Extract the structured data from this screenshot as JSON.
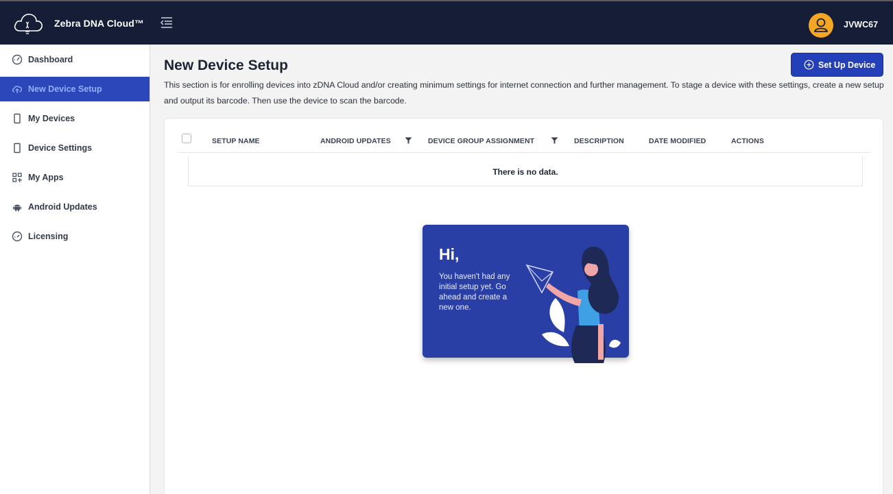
{
  "header": {
    "brand": "Zebra DNA Cloud™",
    "username": "JVWC67"
  },
  "sidebar": {
    "items": [
      {
        "label": "Dashboard",
        "icon": "dashboard-icon"
      },
      {
        "label": "New Device Setup",
        "icon": "cloud-upload-icon",
        "active": true
      },
      {
        "label": "My Devices",
        "icon": "phone-icon"
      },
      {
        "label": "Device Settings",
        "icon": "phone-icon"
      },
      {
        "label": "My Apps",
        "icon": "apps-icon"
      },
      {
        "label": "Android Updates",
        "icon": "android-icon"
      },
      {
        "label": "Licensing",
        "icon": "gauge-icon"
      }
    ]
  },
  "main": {
    "title": "New Device Setup",
    "description": "This section is for enrolling devices into zDNA Cloud and/or creating minimum settings for internet connection and further management. To stage a device with these settings, create a new setup and output its barcode. Then use the device to scan the barcode.",
    "setup_button": "Set Up Device",
    "table": {
      "columns": [
        "SETUP NAME",
        "ANDROID UPDATES",
        "DEVICE GROUP ASSIGNMENT",
        "DESCRIPTION",
        "DATE MODIFIED",
        "ACTIONS"
      ],
      "empty_text": "There is no data."
    },
    "empty_state": {
      "title": "Hi,",
      "message": "You haven't had any initial setup yet. Go ahead and create a new one."
    }
  },
  "colors": {
    "topbar": "#161d37",
    "accent": "#2b47b9",
    "avatar": "#f5a623"
  }
}
